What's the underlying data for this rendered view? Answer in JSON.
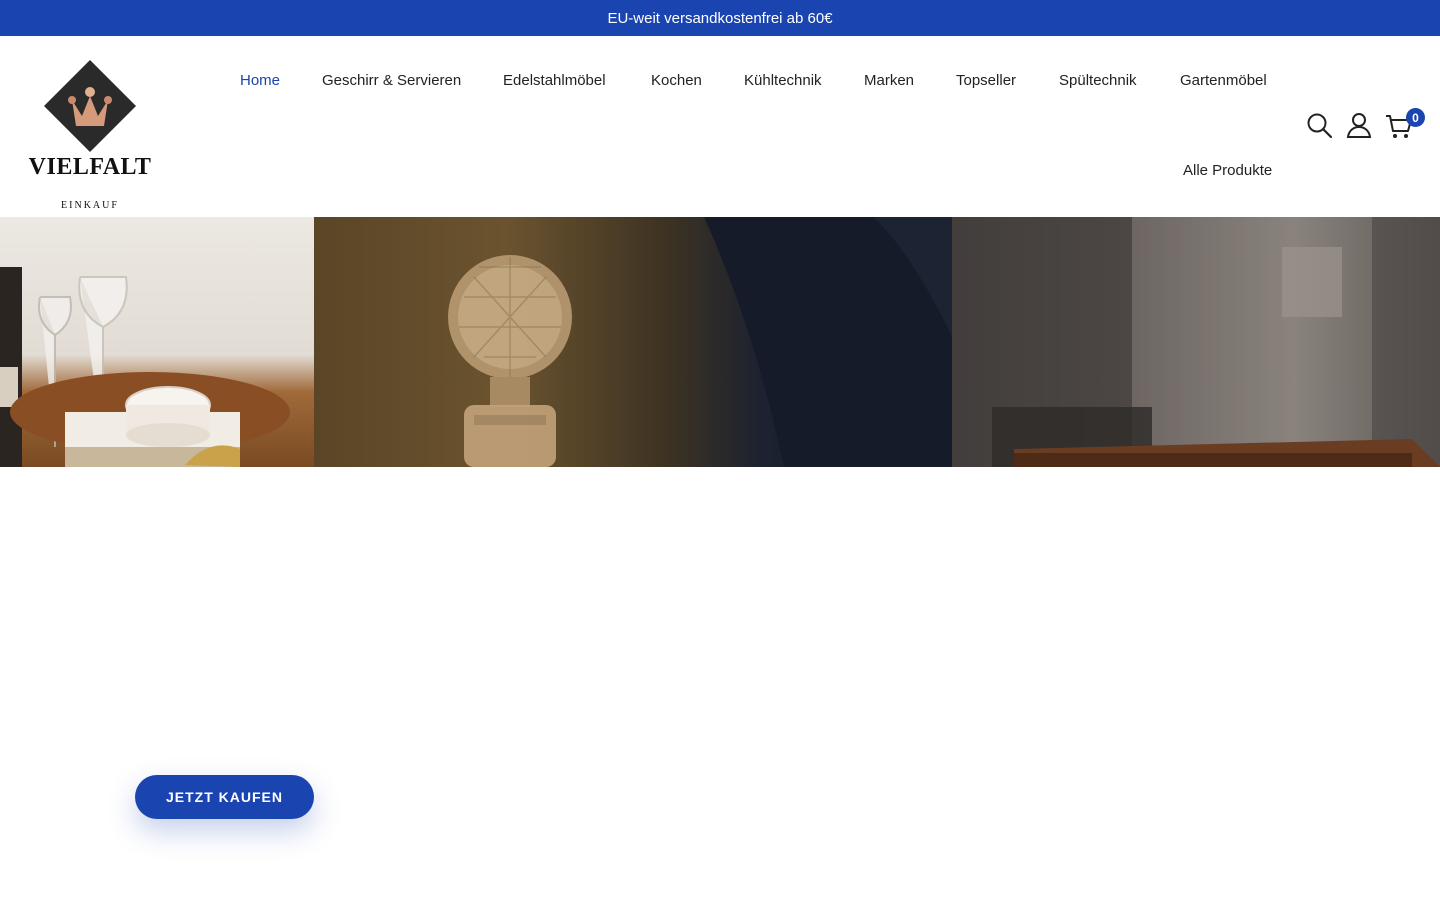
{
  "announcement": {
    "text": "EU-weit versandkostenfrei ab 60€"
  },
  "brand": {
    "name": "VIELFALT",
    "tagline": "EINKAUF"
  },
  "nav": {
    "items": [
      {
        "label": "Home"
      },
      {
        "label": "Geschirr & Servieren"
      },
      {
        "label": "Edelstahlmöbel"
      },
      {
        "label": "Kochen"
      },
      {
        "label": "Kühltechnik"
      },
      {
        "label": "Marken"
      },
      {
        "label": "Topseller"
      },
      {
        "label": "Spültechnik"
      },
      {
        "label": "Gartenmöbel"
      },
      {
        "label": "Alle Produkte"
      }
    ],
    "active_label": "Home"
  },
  "header_icons": {
    "search": "search-icon",
    "account": "user-icon",
    "cart": "cart-icon",
    "cart_count": "0"
  },
  "hero": {
    "cta_label": "JETZT KAUFEN"
  },
  "colors": {
    "accent": "#1a44b0"
  }
}
